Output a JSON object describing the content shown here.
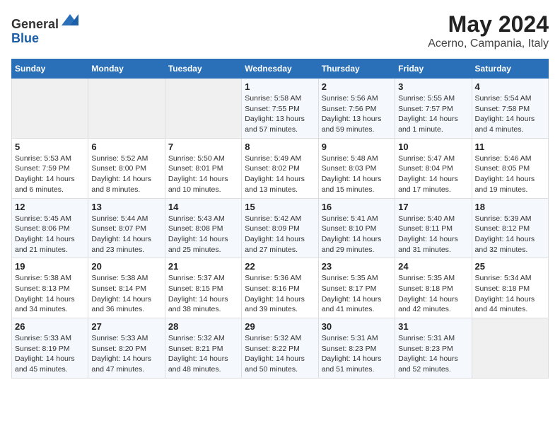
{
  "header": {
    "logo_line1": "General",
    "logo_line2": "Blue",
    "title": "May 2024",
    "subtitle": "Acerno, Campania, Italy"
  },
  "weekdays": [
    "Sunday",
    "Monday",
    "Tuesday",
    "Wednesday",
    "Thursday",
    "Friday",
    "Saturday"
  ],
  "weeks": [
    [
      {
        "day": "",
        "sunrise": "",
        "sunset": "",
        "daylight": ""
      },
      {
        "day": "",
        "sunrise": "",
        "sunset": "",
        "daylight": ""
      },
      {
        "day": "",
        "sunrise": "",
        "sunset": "",
        "daylight": ""
      },
      {
        "day": "1",
        "sunrise": "Sunrise: 5:58 AM",
        "sunset": "Sunset: 7:55 PM",
        "daylight": "Daylight: 13 hours and 57 minutes."
      },
      {
        "day": "2",
        "sunrise": "Sunrise: 5:56 AM",
        "sunset": "Sunset: 7:56 PM",
        "daylight": "Daylight: 13 hours and 59 minutes."
      },
      {
        "day": "3",
        "sunrise": "Sunrise: 5:55 AM",
        "sunset": "Sunset: 7:57 PM",
        "daylight": "Daylight: 14 hours and 1 minute."
      },
      {
        "day": "4",
        "sunrise": "Sunrise: 5:54 AM",
        "sunset": "Sunset: 7:58 PM",
        "daylight": "Daylight: 14 hours and 4 minutes."
      }
    ],
    [
      {
        "day": "5",
        "sunrise": "Sunrise: 5:53 AM",
        "sunset": "Sunset: 7:59 PM",
        "daylight": "Daylight: 14 hours and 6 minutes."
      },
      {
        "day": "6",
        "sunrise": "Sunrise: 5:52 AM",
        "sunset": "Sunset: 8:00 PM",
        "daylight": "Daylight: 14 hours and 8 minutes."
      },
      {
        "day": "7",
        "sunrise": "Sunrise: 5:50 AM",
        "sunset": "Sunset: 8:01 PM",
        "daylight": "Daylight: 14 hours and 10 minutes."
      },
      {
        "day": "8",
        "sunrise": "Sunrise: 5:49 AM",
        "sunset": "Sunset: 8:02 PM",
        "daylight": "Daylight: 14 hours and 13 minutes."
      },
      {
        "day": "9",
        "sunrise": "Sunrise: 5:48 AM",
        "sunset": "Sunset: 8:03 PM",
        "daylight": "Daylight: 14 hours and 15 minutes."
      },
      {
        "day": "10",
        "sunrise": "Sunrise: 5:47 AM",
        "sunset": "Sunset: 8:04 PM",
        "daylight": "Daylight: 14 hours and 17 minutes."
      },
      {
        "day": "11",
        "sunrise": "Sunrise: 5:46 AM",
        "sunset": "Sunset: 8:05 PM",
        "daylight": "Daylight: 14 hours and 19 minutes."
      }
    ],
    [
      {
        "day": "12",
        "sunrise": "Sunrise: 5:45 AM",
        "sunset": "Sunset: 8:06 PM",
        "daylight": "Daylight: 14 hours and 21 minutes."
      },
      {
        "day": "13",
        "sunrise": "Sunrise: 5:44 AM",
        "sunset": "Sunset: 8:07 PM",
        "daylight": "Daylight: 14 hours and 23 minutes."
      },
      {
        "day": "14",
        "sunrise": "Sunrise: 5:43 AM",
        "sunset": "Sunset: 8:08 PM",
        "daylight": "Daylight: 14 hours and 25 minutes."
      },
      {
        "day": "15",
        "sunrise": "Sunrise: 5:42 AM",
        "sunset": "Sunset: 8:09 PM",
        "daylight": "Daylight: 14 hours and 27 minutes."
      },
      {
        "day": "16",
        "sunrise": "Sunrise: 5:41 AM",
        "sunset": "Sunset: 8:10 PM",
        "daylight": "Daylight: 14 hours and 29 minutes."
      },
      {
        "day": "17",
        "sunrise": "Sunrise: 5:40 AM",
        "sunset": "Sunset: 8:11 PM",
        "daylight": "Daylight: 14 hours and 31 minutes."
      },
      {
        "day": "18",
        "sunrise": "Sunrise: 5:39 AM",
        "sunset": "Sunset: 8:12 PM",
        "daylight": "Daylight: 14 hours and 32 minutes."
      }
    ],
    [
      {
        "day": "19",
        "sunrise": "Sunrise: 5:38 AM",
        "sunset": "Sunset: 8:13 PM",
        "daylight": "Daylight: 14 hours and 34 minutes."
      },
      {
        "day": "20",
        "sunrise": "Sunrise: 5:38 AM",
        "sunset": "Sunset: 8:14 PM",
        "daylight": "Daylight: 14 hours and 36 minutes."
      },
      {
        "day": "21",
        "sunrise": "Sunrise: 5:37 AM",
        "sunset": "Sunset: 8:15 PM",
        "daylight": "Daylight: 14 hours and 38 minutes."
      },
      {
        "day": "22",
        "sunrise": "Sunrise: 5:36 AM",
        "sunset": "Sunset: 8:16 PM",
        "daylight": "Daylight: 14 hours and 39 minutes."
      },
      {
        "day": "23",
        "sunrise": "Sunrise: 5:35 AM",
        "sunset": "Sunset: 8:17 PM",
        "daylight": "Daylight: 14 hours and 41 minutes."
      },
      {
        "day": "24",
        "sunrise": "Sunrise: 5:35 AM",
        "sunset": "Sunset: 8:18 PM",
        "daylight": "Daylight: 14 hours and 42 minutes."
      },
      {
        "day": "25",
        "sunrise": "Sunrise: 5:34 AM",
        "sunset": "Sunset: 8:18 PM",
        "daylight": "Daylight: 14 hours and 44 minutes."
      }
    ],
    [
      {
        "day": "26",
        "sunrise": "Sunrise: 5:33 AM",
        "sunset": "Sunset: 8:19 PM",
        "daylight": "Daylight: 14 hours and 45 minutes."
      },
      {
        "day": "27",
        "sunrise": "Sunrise: 5:33 AM",
        "sunset": "Sunset: 8:20 PM",
        "daylight": "Daylight: 14 hours and 47 minutes."
      },
      {
        "day": "28",
        "sunrise": "Sunrise: 5:32 AM",
        "sunset": "Sunset: 8:21 PM",
        "daylight": "Daylight: 14 hours and 48 minutes."
      },
      {
        "day": "29",
        "sunrise": "Sunrise: 5:32 AM",
        "sunset": "Sunset: 8:22 PM",
        "daylight": "Daylight: 14 hours and 50 minutes."
      },
      {
        "day": "30",
        "sunrise": "Sunrise: 5:31 AM",
        "sunset": "Sunset: 8:23 PM",
        "daylight": "Daylight: 14 hours and 51 minutes."
      },
      {
        "day": "31",
        "sunrise": "Sunrise: 5:31 AM",
        "sunset": "Sunset: 8:23 PM",
        "daylight": "Daylight: 14 hours and 52 minutes."
      },
      {
        "day": "",
        "sunrise": "",
        "sunset": "",
        "daylight": ""
      }
    ]
  ]
}
